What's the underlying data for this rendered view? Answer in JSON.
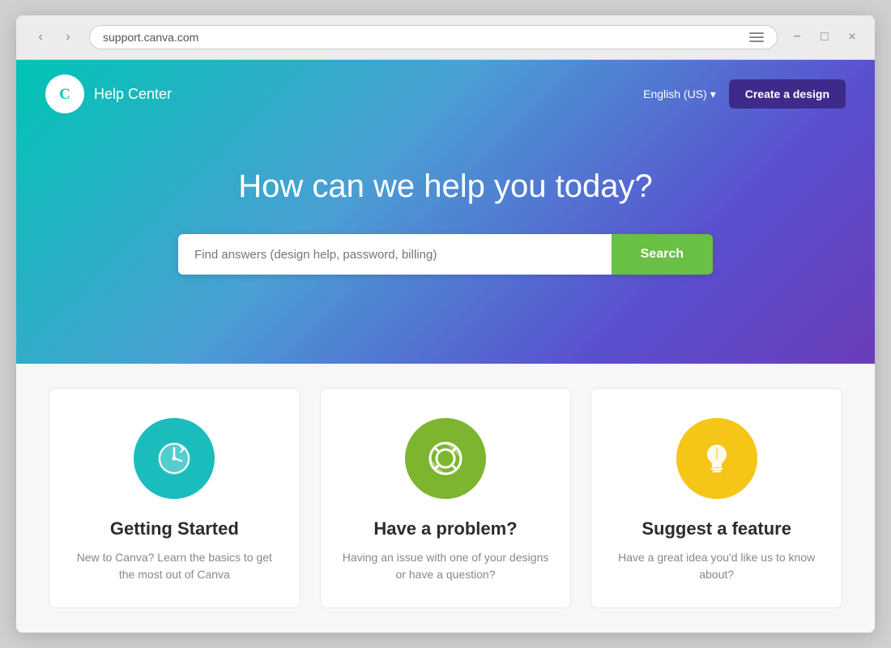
{
  "browser": {
    "url": "support.canva.com",
    "back_icon": "‹",
    "forward_icon": "›",
    "minimize_icon": "−",
    "maximize_icon": "□",
    "close_icon": "×"
  },
  "nav": {
    "brand_logo_alt": "Canva",
    "help_center_label": "Help Center",
    "language_label": "English (US)",
    "create_design_btn": "Create a design"
  },
  "hero": {
    "title": "How can we help you today?",
    "search_placeholder": "Find answers (design help, password, billing)",
    "search_btn_label": "Search"
  },
  "cards": [
    {
      "id": "getting-started",
      "title": "Getting Started",
      "description": "New to Canva? Learn the basics to get the most out of Canva",
      "icon_color": "#1bbcbc",
      "icon_type": "clock"
    },
    {
      "id": "have-a-problem",
      "title": "Have a problem?",
      "description": "Having an issue with one of your designs or have a question?",
      "icon_color": "#7db52f",
      "icon_type": "lifering"
    },
    {
      "id": "suggest-feature",
      "title": "Suggest a feature",
      "description": "Have a great idea you'd like us to know about?",
      "icon_color": "#f5c518",
      "icon_type": "lightbulb"
    }
  ]
}
